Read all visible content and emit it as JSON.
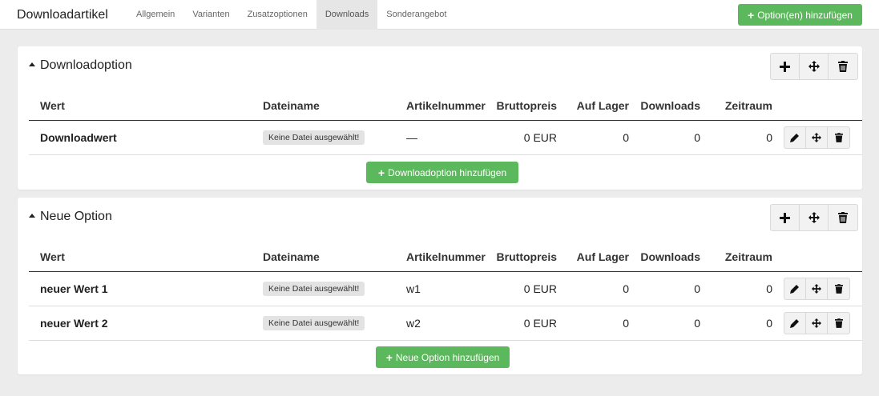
{
  "app": {
    "title": "Downloadartikel",
    "add_button": "Option(en) hinzufügen"
  },
  "tabs": [
    {
      "label": "Allgemein",
      "active": false
    },
    {
      "label": "Varianten",
      "active": false
    },
    {
      "label": "Zusatzoptionen",
      "active": false
    },
    {
      "label": "Downloads",
      "active": true
    },
    {
      "label": "Sonderangebot",
      "active": false
    }
  ],
  "columns": [
    "Wert",
    "Dateiname",
    "Artikelnummer",
    "Bruttopreis",
    "Auf Lager",
    "Downloads",
    "Zeitraum"
  ],
  "panels": [
    {
      "title": "Downloadoption",
      "add_label": "Downloadoption hinzufügen",
      "rows": [
        {
          "wert": "Downloadwert",
          "datei": "Keine Datei ausgewählt!",
          "artikelnummer": "—",
          "preis": "0 EUR",
          "lager": "0",
          "downloads": "0",
          "zeitraum": "0"
        }
      ]
    },
    {
      "title": "Neue Option",
      "add_label": "Neue Option hinzufügen",
      "rows": [
        {
          "wert": "neuer Wert 1",
          "datei": "Keine Datei ausgewählt!",
          "artikelnummer": "w1",
          "preis": "0 EUR",
          "lager": "0",
          "downloads": "0",
          "zeitraum": "0"
        },
        {
          "wert": "neuer Wert 2",
          "datei": "Keine Datei ausgewählt!",
          "artikelnummer": "w2",
          "preis": "0 EUR",
          "lager": "0",
          "downloads": "0",
          "zeitraum": "0"
        }
      ]
    }
  ],
  "colors": {
    "accent": "#5cb85c",
    "background": "#ececec"
  },
  "icons": [
    "plus-icon",
    "move-icon",
    "trash-icon",
    "pencil-icon",
    "caret-up-icon"
  ]
}
